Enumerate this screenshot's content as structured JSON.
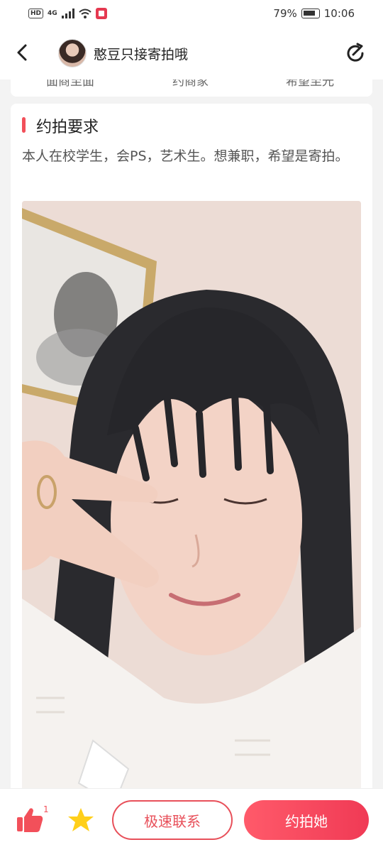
{
  "status_bar": {
    "network": "4G",
    "battery_percent": "79%",
    "time": "10:06"
  },
  "header": {
    "title": "憨豆只接寄拍哦"
  },
  "previous_section": {
    "items": [
      "面商至面",
      "约商家",
      "希望至光"
    ]
  },
  "requirement": {
    "title": "约拍要求",
    "description": "本人在校学生，会PS，艺术生。想兼职，希望是寄拍。"
  },
  "bottom_bar": {
    "like_count": "1",
    "contact_label": "极速联系",
    "book_label": "约拍她"
  },
  "colors": {
    "accent": "#f2505a",
    "star": "#ffcf1a"
  }
}
